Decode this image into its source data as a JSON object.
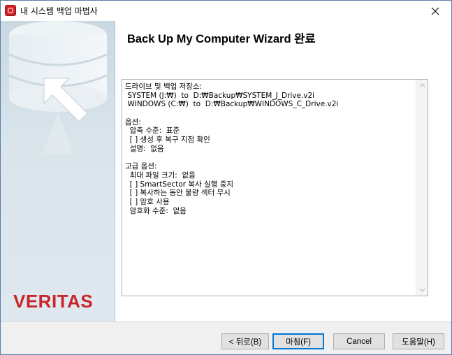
{
  "window": {
    "title": "내 시스템 백업 마법사",
    "close_glyph": "✕"
  },
  "brand": {
    "logo_text": "VERITAS",
    "logo_color": "#c9252c"
  },
  "wizard": {
    "title": "Back Up My Computer Wizard 완료"
  },
  "summary": {
    "lines": [
      "드라이브 및 백업 저장소:",
      " SYSTEM (J:₩)  to  D:₩Backup₩SYSTEM_J_Drive.v2i",
      " WINDOWS (C:₩)  to  D:₩Backup₩WINDOWS_C_Drive.v2i",
      "",
      "옵션:",
      "  압축 수준:  표준",
      "  [ ] 생성 후 복구 지점 확인",
      "  설명:  없음",
      "",
      "고급 옵션:",
      "  최대 파일 크기:  없음",
      "  [ ] SmartSector 복사 실행 중지",
      "  [ ] 복사하는 동안 불량 섹터 무시",
      "  [ ] 암호 사용",
      "  암호화 수준:  없음"
    ]
  },
  "buttons": {
    "back": "< 뒤로(B)",
    "finish": "마침(F)",
    "cancel": "Cancel",
    "help": "도움말(H)"
  },
  "icons": {
    "app": "veritas-app-icon",
    "close": "close-icon",
    "scroll_up": "scroll-up-arrow-icon",
    "scroll_down": "scroll-down-arrow-icon",
    "side": "disk-with-arrow-icon"
  },
  "colors": {
    "accent": "#0078d7",
    "side_panel": "#d5e1e8",
    "brand_red": "#c9252c"
  }
}
